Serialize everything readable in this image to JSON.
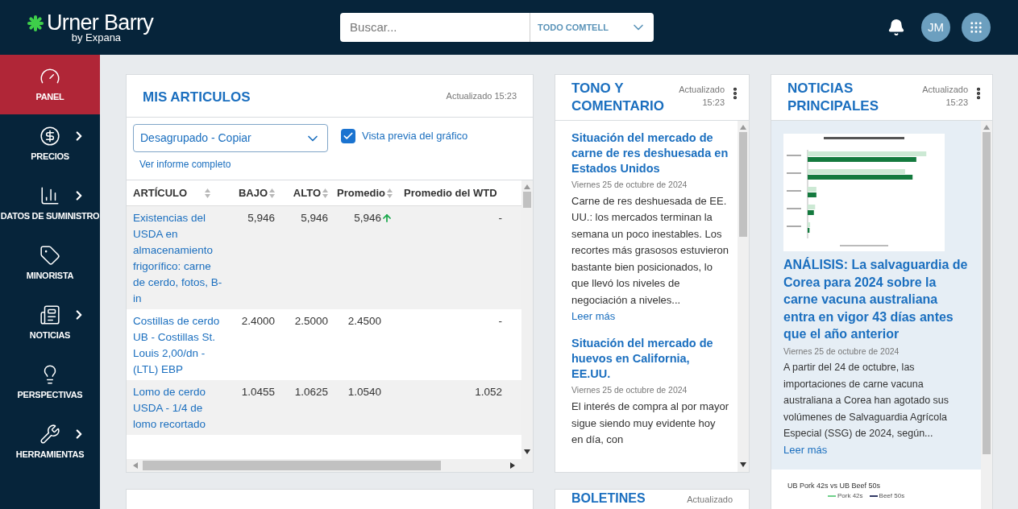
{
  "header": {
    "logo": {
      "name": "Urner Barry",
      "tagline": "by Expana"
    },
    "search": {
      "placeholder": "Buscar...",
      "scope": "TODO COMTELL"
    },
    "avatar": "JM"
  },
  "sidebar": {
    "items": [
      {
        "label": "PANEL",
        "selected": true,
        "has_submenu": false
      },
      {
        "label": "PRECIOS",
        "selected": false,
        "has_submenu": true
      },
      {
        "label": "DATOS DE SUMINISTRO",
        "selected": false,
        "has_submenu": true
      },
      {
        "label": "MINORISTA",
        "selected": false,
        "has_submenu": false
      },
      {
        "label": "NOTICIAS",
        "selected": false,
        "has_submenu": true
      },
      {
        "label": "PERSPECTIVAS",
        "selected": false,
        "has_submenu": false
      },
      {
        "label": "HERRAMIENTAS",
        "selected": false,
        "has_submenu": true
      }
    ]
  },
  "my_items": {
    "title": "MIS ARTICULOS",
    "updated": "Actualizado 15:23",
    "group_select": "Desagrupado - Copiar",
    "chart_preview": {
      "label": "Vista previa del gráfico",
      "checked": true
    },
    "report_link": "Ver informe completo",
    "columns": [
      "ARTÍCULO",
      "BAJO",
      "ALTO",
      "Promedio",
      "Promedio del WTD"
    ],
    "rows": [
      {
        "cells": [
          "Existencias del USDA en almacenamiento frigorífico: carne de cerdo, fotos, B-in",
          "5,946",
          "5,946",
          "5,946",
          "-"
        ],
        "rising": true
      },
      {
        "cells": [
          "Costillas de cerdo UB - Costillas St. Louis 2,00/dn - (LTL) EBP",
          "2.4000",
          "2.5000",
          "2.4500",
          "-"
        ],
        "rising": false
      },
      {
        "cells": [
          "Lomo de cerdo USDA - 1/4 de lomo recortado",
          "1.0455",
          "1.0625",
          "1.0540",
          "1.052"
        ],
        "rising": false
      }
    ]
  },
  "tone": {
    "title": "TONO Y COMENTARIO",
    "updated": "Actualizado 15:23",
    "articles": [
      {
        "title": "Situación del mercado de carne de res deshuesada en Estados Unidos",
        "date": "Viernes 25 de octubre de 2024",
        "summary": "Carne de res deshuesada de EE. UU.: los mercados terminan la semana un poco inestables. Los recortes más grasosos estuvieron bastante bien posicionados, lo que llevó los niveles de negociación a niveles...",
        "more": "Leer más"
      },
      {
        "title": "Situación del mercado de huevos en California, EE.UU.",
        "date": "Viernes 25 de octubre de 2024",
        "summary": "El interés de compra al por mayor sigue siendo muy evidente hoy en día, con"
      }
    ]
  },
  "top_news": {
    "title": "NOTICIAS PRINCIPALES",
    "updated": "Actualizado 15:23",
    "articles": [
      {
        "kind": "picture",
        "title": "ANÁLISIS: La salvaguardia de Corea para 2024 sobre la carne vacuna australiana entra en vigor 43 días antes que el año anterior",
        "date": "Viernes 25 de octubre de 2024",
        "summary": "A partir del 24 de octubre, las importaciones de carne vacuna australiana a Corea han agotado sus volúmenes de Salvaguardia Agrícola Especial (SSG) de 2024, según...",
        "more": "Leer más"
      },
      {
        "kind": "chart",
        "title": "UB Pork 42s vs UB Beef 50s",
        "legend": [
          "Pork 42s",
          "Beef 50s"
        ]
      }
    ]
  },
  "bulletins": {
    "title": "BOLETINES",
    "updated": "Actualizado"
  }
}
